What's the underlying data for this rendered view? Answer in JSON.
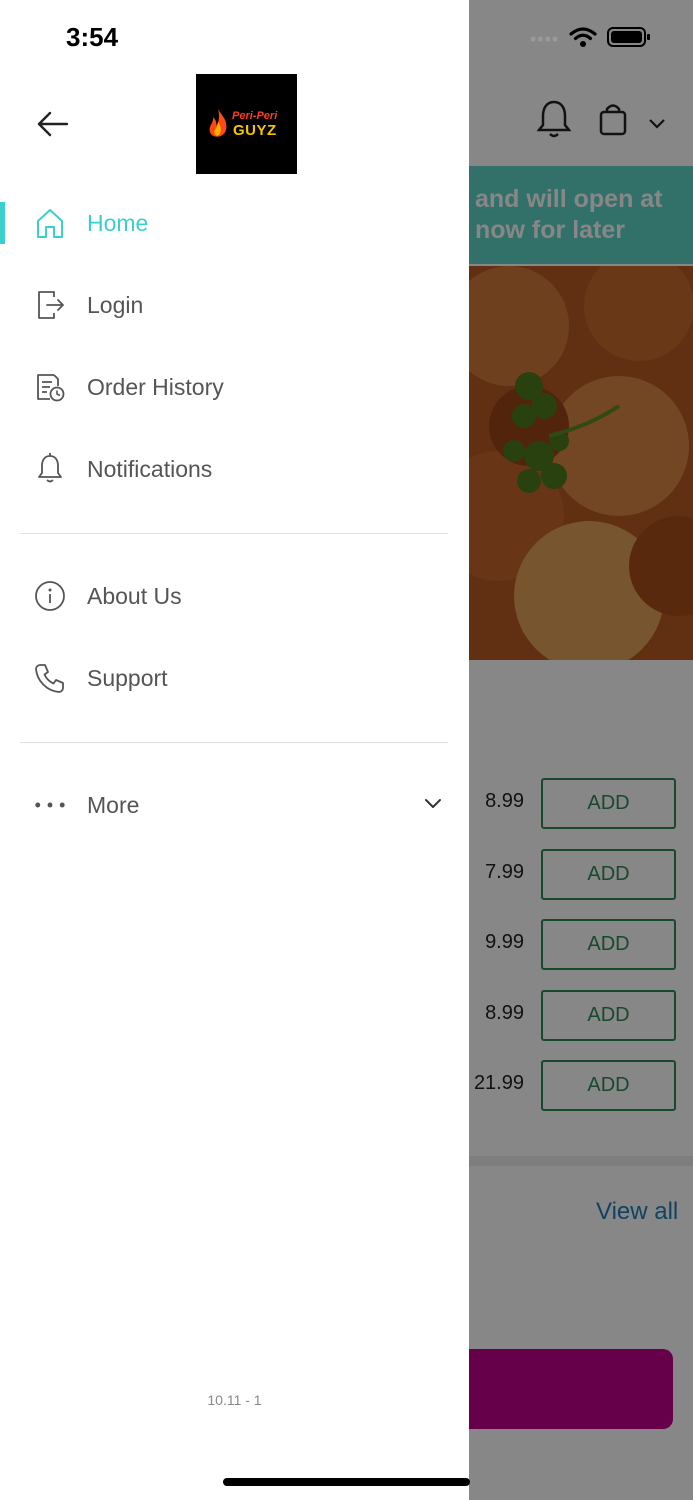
{
  "status_bar": {
    "time": "3:54"
  },
  "drawer": {
    "logo": {
      "line1": "Peri-Peri",
      "line2": "GUYZ"
    },
    "menu": [
      {
        "label": "Home",
        "icon": "home-icon",
        "active": true
      },
      {
        "label": "Login",
        "icon": "login-icon",
        "active": false
      },
      {
        "label": "Order History",
        "icon": "order-history-icon",
        "active": false
      },
      {
        "label": "Notifications",
        "icon": "bell-icon",
        "active": false
      },
      {
        "label": "About Us",
        "icon": "info-icon",
        "active": false
      },
      {
        "label": "Support",
        "icon": "phone-icon",
        "active": false
      },
      {
        "label": "More",
        "icon": "more-dots-icon",
        "active": false
      }
    ],
    "version": "10.11 - 1"
  },
  "background": {
    "banner_lines": [
      "and will open at",
      "now for later"
    ],
    "items": [
      {
        "price": "8.99",
        "button": "ADD"
      },
      {
        "price": "7.99",
        "button": "ADD"
      },
      {
        "price": "9.99",
        "button": "ADD"
      },
      {
        "price": "8.99",
        "button": "ADD"
      },
      {
        "price": "21.99",
        "button": "ADD"
      }
    ],
    "view_all": "View all"
  },
  "colors": {
    "accent": "#3ccfcf",
    "add_button": "#2e8b57",
    "cta": "#c2008e",
    "link": "#1f7fb8"
  }
}
